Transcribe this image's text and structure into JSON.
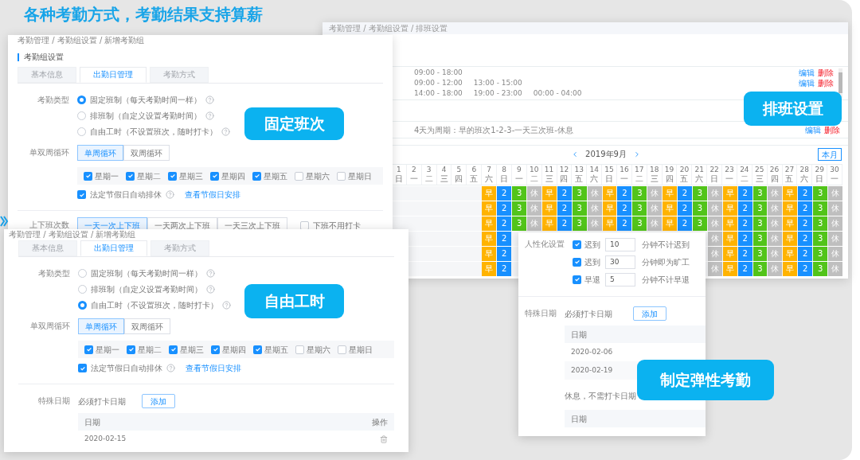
{
  "headline": "各种考勤方式，考勤结果支持算薪",
  "schedule_window": {
    "breadcrumb": "考勤管理 / 考勤组设置 / 排班设置",
    "shifts": [
      {
        "times": [
          "09:00 - 18:00"
        ],
        "edit": "编辑",
        "delete": "删除"
      },
      {
        "times": [
          "09:00 - 12:00",
          "13:00 - 15:00"
        ],
        "edit": "编辑",
        "delete": "删除"
      },
      {
        "times": [
          "14:00 - 18:00",
          "19:00 - 23:00",
          "00:00 - 04:00"
        ]
      }
    ],
    "cycle": {
      "text": "4天为周期：早的班次1-2-3-一天三次班-休息",
      "edit": "编辑",
      "delete": "删除"
    },
    "calendar": {
      "month": "2019年9月",
      "today": "本月",
      "days": [
        {
          "date": "1",
          "weekday": "日"
        },
        {
          "date": "2",
          "weekday": "一"
        },
        {
          "date": "3",
          "weekday": "二"
        },
        {
          "date": "4",
          "weekday": "三"
        },
        {
          "date": "5",
          "weekday": "四"
        },
        {
          "date": "6",
          "weekday": "五"
        },
        {
          "date": "7",
          "weekday": "六"
        },
        {
          "date": "8",
          "weekday": "日"
        },
        {
          "date": "9",
          "weekday": "一"
        },
        {
          "date": "10",
          "weekday": "二"
        },
        {
          "date": "11",
          "weekday": "三"
        },
        {
          "date": "12",
          "weekday": "四"
        },
        {
          "date": "13",
          "weekday": "五"
        },
        {
          "date": "14",
          "weekday": "六"
        },
        {
          "date": "15",
          "weekday": "日"
        },
        {
          "date": "16",
          "weekday": "一"
        },
        {
          "date": "17",
          "weekday": "二"
        },
        {
          "date": "18",
          "weekday": "三"
        },
        {
          "date": "19",
          "weekday": "四"
        },
        {
          "date": "20",
          "weekday": "五"
        },
        {
          "date": "21",
          "weekday": "六"
        },
        {
          "date": "22",
          "weekday": "日"
        },
        {
          "date": "23",
          "weekday": "一"
        },
        {
          "date": "24",
          "weekday": "二"
        },
        {
          "date": "25",
          "weekday": "三"
        },
        {
          "date": "26",
          "weekday": "四"
        },
        {
          "date": "27",
          "weekday": "五"
        },
        {
          "date": "28",
          "weekday": "六"
        },
        {
          "date": "29",
          "weekday": "日"
        },
        {
          "date": "30",
          "weekday": "一"
        }
      ],
      "rows": [
        [
          null,
          null,
          null,
          null,
          null,
          null,
          {
            "text": "早",
            "color": "#ffb300"
          },
          {
            "text": "2",
            "color": "#1890ff"
          },
          {
            "text": "3",
            "color": "#52c41a"
          },
          {
            "text": "休",
            "color": "#bfbfbf"
          },
          {
            "text": "早",
            "color": "#ffb300"
          },
          {
            "text": "2",
            "color": "#1890ff"
          },
          {
            "text": "3",
            "color": "#52c41a"
          },
          {
            "text": "休",
            "color": "#bfbfbf"
          },
          {
            "text": "早",
            "color": "#ffb300"
          },
          {
            "text": "2",
            "color": "#1890ff"
          },
          {
            "text": "3",
            "color": "#52c41a"
          },
          {
            "text": "休",
            "color": "#bfbfbf"
          },
          {
            "text": "早",
            "color": "#ffb300"
          },
          {
            "text": "2",
            "color": "#1890ff"
          },
          {
            "text": "3",
            "color": "#52c41a"
          },
          {
            "text": "休",
            "color": "#bfbfbf"
          },
          {
            "text": "早",
            "color": "#ffb300"
          },
          {
            "text": "2",
            "color": "#1890ff"
          },
          {
            "text": "3",
            "color": "#52c41a"
          },
          {
            "text": "休",
            "color": "#bfbfbf"
          },
          {
            "text": "早",
            "color": "#ffb300"
          },
          {
            "text": "2",
            "color": "#1890ff"
          },
          {
            "text": "3",
            "color": "#52c41a"
          },
          {
            "text": "休",
            "color": "#bfbfbf"
          }
        ],
        [
          null,
          null,
          null,
          null,
          null,
          null,
          {
            "text": "早",
            "color": "#ffb300"
          },
          {
            "text": "2",
            "color": "#1890ff"
          },
          {
            "text": "3",
            "color": "#52c41a"
          },
          {
            "text": "休",
            "color": "#bfbfbf"
          },
          {
            "text": "早",
            "color": "#ffb300"
          },
          {
            "text": "2",
            "color": "#1890ff"
          },
          {
            "text": "3",
            "color": "#52c41a"
          },
          {
            "text": "休",
            "color": "#bfbfbf"
          },
          {
            "text": "早",
            "color": "#ffb300"
          },
          {
            "text": "2",
            "color": "#1890ff"
          },
          {
            "text": "3",
            "color": "#52c41a"
          },
          {
            "text": "休",
            "color": "#bfbfbf"
          },
          {
            "text": "早",
            "color": "#ffb300"
          },
          {
            "text": "2",
            "color": "#1890ff"
          },
          {
            "text": "3",
            "color": "#52c41a"
          },
          {
            "text": "休",
            "color": "#bfbfbf"
          },
          {
            "text": "早",
            "color": "#ffb300"
          },
          {
            "text": "2",
            "color": "#1890ff"
          },
          {
            "text": "3",
            "color": "#52c41a"
          },
          {
            "text": "休",
            "color": "#bfbfbf"
          },
          {
            "text": "早",
            "color": "#ffb300"
          },
          {
            "text": "2",
            "color": "#1890ff"
          },
          {
            "text": "3",
            "color": "#52c41a"
          },
          {
            "text": "休",
            "color": "#bfbfbf"
          }
        ],
        [
          null,
          null,
          null,
          null,
          null,
          null,
          {
            "text": "早",
            "color": "#ffb300"
          },
          {
            "text": "2",
            "color": "#1890ff"
          },
          {
            "text": "3",
            "color": "#52c41a"
          },
          {
            "text": "休",
            "color": "#bfbfbf"
          },
          {
            "text": "早",
            "color": "#ffb300"
          },
          {
            "text": "2",
            "color": "#1890ff"
          },
          {
            "text": "3",
            "color": "#52c41a"
          },
          {
            "text": "休",
            "color": "#bfbfbf"
          },
          {
            "text": "早",
            "color": "#ffb300"
          },
          {
            "text": "2",
            "color": "#1890ff"
          },
          {
            "text": "3",
            "color": "#52c41a"
          },
          {
            "text": "休",
            "color": "#bfbfbf"
          },
          {
            "text": "早",
            "color": "#ffb300"
          },
          {
            "text": "2",
            "color": "#1890ff"
          },
          {
            "text": "3",
            "color": "#52c41a"
          },
          {
            "text": "休",
            "color": "#bfbfbf"
          },
          {
            "text": "早",
            "color": "#ffb300"
          },
          {
            "text": "2",
            "color": "#1890ff"
          },
          {
            "text": "3",
            "color": "#52c41a"
          },
          {
            "text": "休",
            "color": "#bfbfbf"
          },
          {
            "text": "早",
            "color": "#ffb300"
          },
          {
            "text": "2",
            "color": "#1890ff"
          },
          {
            "text": "3",
            "color": "#52c41a"
          },
          {
            "text": "休",
            "color": "#bfbfbf"
          }
        ],
        [
          null,
          null,
          null,
          null,
          null,
          null,
          {
            "text": "早",
            "color": "#ffb300"
          },
          {
            "text": "2",
            "color": "#1890ff"
          },
          null,
          null,
          null,
          null,
          null,
          null,
          null,
          null,
          null,
          null,
          null,
          null,
          null,
          {
            "text": "休",
            "color": "#bfbfbf"
          },
          {
            "text": "早",
            "color": "#ffb300"
          },
          {
            "text": "2",
            "color": "#1890ff"
          },
          {
            "text": "3",
            "color": "#52c41a"
          },
          {
            "text": "休",
            "color": "#bfbfbf"
          },
          {
            "text": "早",
            "color": "#ffb300"
          },
          {
            "text": "2",
            "color": "#1890ff"
          },
          {
            "text": "3",
            "color": "#52c41a"
          },
          {
            "text": "休",
            "color": "#bfbfbf"
          }
        ],
        [
          null,
          null,
          null,
          null,
          null,
          null,
          {
            "text": "早",
            "color": "#ffb300"
          },
          {
            "text": "2",
            "color": "#1890ff"
          },
          null,
          null,
          null,
          null,
          null,
          null,
          null,
          null,
          null,
          null,
          null,
          null,
          null,
          {
            "text": "休",
            "color": "#bfbfbf"
          },
          {
            "text": "早",
            "color": "#ffb300"
          },
          {
            "text": "2",
            "color": "#1890ff"
          },
          {
            "text": "3",
            "color": "#52c41a"
          },
          {
            "text": "休",
            "color": "#bfbfbf"
          },
          {
            "text": "早",
            "color": "#ffb300"
          },
          {
            "text": "2",
            "color": "#1890ff"
          },
          {
            "text": "3",
            "color": "#52c41a"
          },
          {
            "text": "休",
            "color": "#bfbfbf"
          }
        ],
        [
          null,
          null,
          null,
          null,
          null,
          null,
          {
            "text": "早",
            "color": "#ffb300"
          },
          {
            "text": "2",
            "color": "#1890ff"
          },
          null,
          null,
          null,
          null,
          null,
          null,
          null,
          null,
          null,
          null,
          null,
          null,
          null,
          {
            "text": "休",
            "color": "#bfbfbf"
          },
          {
            "text": "早",
            "color": "#ffb300"
          },
          {
            "text": "2",
            "color": "#1890ff"
          },
          {
            "text": "3",
            "color": "#52c41a"
          },
          {
            "text": "休",
            "color": "#bfbfbf"
          },
          {
            "text": "早",
            "color": "#ffb300"
          },
          {
            "text": "2",
            "color": "#1890ff"
          },
          {
            "text": "3",
            "color": "#52c41a"
          },
          {
            "text": "休",
            "color": "#bfbfbf"
          }
        ]
      ]
    },
    "badge": "排班设置"
  },
  "fixed_window": {
    "breadcrumb": "考勤管理 / 考勤组设置 / 新增考勤组",
    "section_title": "考勤组设置",
    "tabs": [
      {
        "label": "基本信息",
        "selected": false
      },
      {
        "label": "出勤日管理",
        "selected": true
      },
      {
        "label": "考勤方式",
        "selected": false
      }
    ],
    "type_label": "考勤类型",
    "types": [
      {
        "label": "固定班制（每天考勤时间一样）",
        "selected": true
      },
      {
        "label": "排班制（自定义设置考勤时间）",
        "selected": false
      },
      {
        "label": "自由工时（不设置班次，随时打卡）",
        "selected": false
      }
    ],
    "cycle_label": "单双周循环",
    "cycle_options": [
      {
        "label": "单周循环",
        "selected": true
      },
      {
        "label": "双周循环",
        "selected": false
      }
    ],
    "weekdays": [
      {
        "label": "星期一",
        "checked": true
      },
      {
        "label": "星期二",
        "checked": true
      },
      {
        "label": "星期三",
        "checked": true
      },
      {
        "label": "星期四",
        "checked": true
      },
      {
        "label": "星期五",
        "checked": true
      },
      {
        "label": "星期六",
        "checked": false
      },
      {
        "label": "星期日",
        "checked": false
      }
    ],
    "holiday": {
      "label": "法定节假日自动排休",
      "checked": true,
      "link": "查看节假日安排"
    },
    "shift_count": {
      "label": "上下班次数",
      "options": [
        {
          "label": "一天一次上下班",
          "selected": true
        },
        {
          "label": "一天两次上下班",
          "selected": false
        },
        {
          "label": "一天三次上下班",
          "selected": false
        }
      ],
      "no_punch": {
        "label": "下班不用打卡",
        "checked": false
      }
    },
    "badge": "固定班次"
  },
  "free_window": {
    "breadcrumb": "考勤管理 / 考勤组设置 / 新增考勤组",
    "tabs": [
      {
        "label": "基本信息",
        "selected": false
      },
      {
        "label": "出勤日管理",
        "selected": true
      },
      {
        "label": "考勤方式",
        "selected": false
      }
    ],
    "type_label": "考勤类型",
    "types": [
      {
        "label": "固定班制（每天考勤时间一样）",
        "selected": false
      },
      {
        "label": "排班制（自定义设置考勤时间）",
        "selected": false
      },
      {
        "label": "自由工时（不设置班次，随时打卡）",
        "selected": true
      }
    ],
    "cycle_label": "单双周循环",
    "cycle_options": [
      {
        "label": "单周循环",
        "selected": true
      },
      {
        "label": "双周循环",
        "selected": false
      }
    ],
    "weekdays": [
      {
        "label": "星期一",
        "checked": true
      },
      {
        "label": "星期二",
        "checked": true
      },
      {
        "label": "星期三",
        "checked": true
      },
      {
        "label": "星期四",
        "checked": true
      },
      {
        "label": "星期五",
        "checked": true
      },
      {
        "label": "星期六",
        "checked": false
      },
      {
        "label": "星期日",
        "checked": false
      }
    ],
    "holiday": {
      "label": "法定节假日自动排休",
      "checked": true,
      "link": "查看节假日安排"
    },
    "special_dates": {
      "label": "特殊日期",
      "sub_label": "必须打卡日期",
      "add": "添加",
      "columns": [
        "日期",
        "操作"
      ],
      "rows": [
        "2020-02-15"
      ]
    },
    "badge": "自由工时"
  },
  "flex_window": {
    "personal_label": "人性化设置",
    "rules": [
      {
        "checked": true,
        "label": "迟到",
        "value": "10",
        "suffix": "分钟不计迟到"
      },
      {
        "checked": true,
        "label": "迟到",
        "value": "30",
        "suffix": "分钟即为旷工"
      },
      {
        "checked": true,
        "label": "早退",
        "value": "5",
        "suffix": "分钟不计早退"
      }
    ],
    "special_label": "特殊日期",
    "required": {
      "label": "必须打卡日期",
      "add": "添加",
      "column": "日期",
      "rows": [
        "2020-02-06",
        "2020-02-19"
      ]
    },
    "rest": {
      "label": "休息，不需打卡日期",
      "column": "日期"
    },
    "badge": "制定弹性考勤"
  }
}
